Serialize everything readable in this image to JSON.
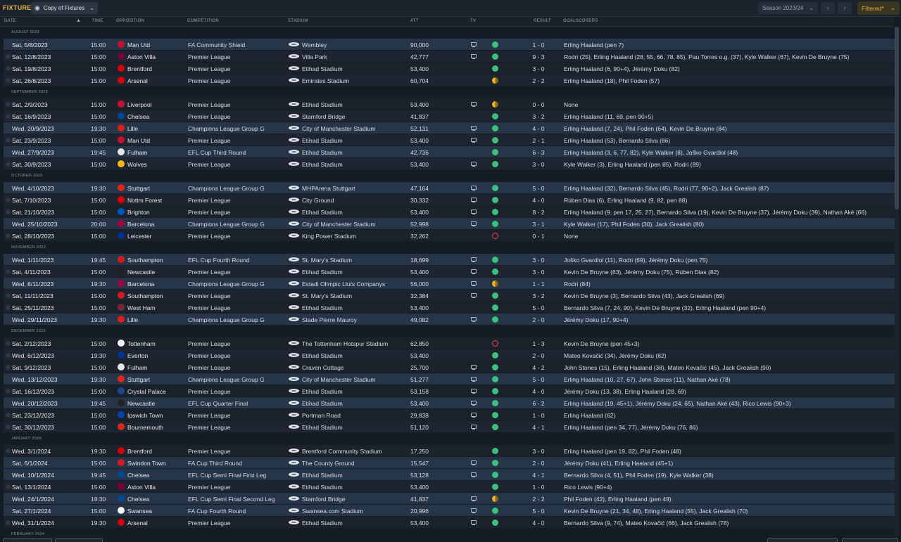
{
  "screen": {
    "title": "FIXTURES",
    "view_label": "Copy of Fixtures",
    "season_label": "Season 2023/24",
    "filter_label": "Filtered*"
  },
  "columns": {
    "date": "DATE",
    "time": "TIME",
    "opposition": "OPPOSITION",
    "competition": "COMPETITION",
    "stadium": "STADIUM",
    "att": "ATT",
    "tv": "TV",
    "result": "RESULT",
    "goalscorers": "GOALSCORERS"
  },
  "colors": {
    "win": "#3cc07f",
    "draw": "#f0b429",
    "loss": "#e04848",
    "accent": "#e3b341"
  },
  "months": [
    {
      "label": "AUGUST 2023",
      "fixtures": [
        {
          "date": "Sat, 5/8/2023",
          "time": "15:00",
          "opp": "Man Utd",
          "badge": "#c8102e",
          "comp": "FA Community Shield",
          "stadium": "Wembley",
          "att": "90,000",
          "tv": true,
          "outcome": "W",
          "score": "1 - 0",
          "goals": "Erling Haaland (pen 7)",
          "hl": true
        },
        {
          "date": "Sat, 12/8/2023",
          "time": "15:00",
          "opp": "Aston Villa",
          "badge": "#7a003c",
          "comp": "Premier League",
          "stadium": "Villa Park",
          "att": "42,777",
          "tv": true,
          "outcome": "W",
          "score": "9 - 3",
          "goals": "Rodri (25), Erling Haaland (28, 55, 66, 78, 85), Pau Torres o.g. (37), Kyle Walker (67), Kevin De Bruyne (75)"
        },
        {
          "date": "Sat, 19/8/2023",
          "time": "15:00",
          "opp": "Brentford",
          "badge": "#d20000",
          "comp": "Premier League",
          "stadium": "Etihad Stadium",
          "att": "53,400",
          "tv": false,
          "outcome": "W",
          "score": "3 - 0",
          "goals": "Erling Haaland (6, 90+4), Jérémy Doku (82)"
        },
        {
          "date": "Sat, 26/8/2023",
          "time": "15:00",
          "opp": "Arsenal",
          "badge": "#db0007",
          "comp": "Premier League",
          "stadium": "Emirates Stadium",
          "att": "60,704",
          "tv": false,
          "outcome": "D",
          "score": "2 - 2",
          "goals": "Erling Haaland (18), Phil Foden (57)"
        }
      ]
    },
    {
      "label": "SEPTEMBER 2023",
      "fixtures": [
        {
          "date": "Sat, 2/9/2023",
          "time": "15:00",
          "opp": "Liverpool",
          "badge": "#c8102e",
          "comp": "Premier League",
          "stadium": "Etihad Stadium",
          "att": "53,400",
          "tv": true,
          "outcome": "D",
          "score": "0 - 0",
          "goals": "None"
        },
        {
          "date": "Sat, 16/9/2023",
          "time": "15:00",
          "opp": "Chelsea",
          "badge": "#034694",
          "comp": "Premier League",
          "stadium": "Stamford Bridge",
          "att": "41,837",
          "tv": false,
          "outcome": "W",
          "score": "3 - 2",
          "goals": "Erling Haaland (11, 69, pen 90+5)"
        },
        {
          "date": "Wed, 20/9/2023",
          "time": "19:30",
          "opp": "Lille",
          "badge": "#e01e13",
          "comp": "Champions League Group G",
          "stadium": "City of Manchester Stadium",
          "att": "52,131",
          "tv": true,
          "outcome": "W",
          "score": "4 - 0",
          "goals": "Erling Haaland (7, 24), Phil Foden (64), Kevin De Bruyne (84)",
          "hl": true
        },
        {
          "date": "Sat, 23/9/2023",
          "time": "15:00",
          "opp": "Man Utd",
          "badge": "#c8102e",
          "comp": "Premier League",
          "stadium": "Etihad Stadium",
          "att": "53,400",
          "tv": true,
          "outcome": "W",
          "score": "2 - 1",
          "goals": "Erling Haaland (53), Bernardo Silva (86)"
        },
        {
          "date": "Wed, 27/9/2023",
          "time": "19:45",
          "opp": "Fulham",
          "badge": "#e6e6e6",
          "comp": "EFL Cup Third Round",
          "stadium": "Etihad Stadium",
          "att": "42,736",
          "tv": false,
          "outcome": "W",
          "score": "6 - 3",
          "goals": "Erling Haaland (3, 6, 77, 82), Kyle Walker (8), Joško Gvardiol (48)",
          "hl": true
        },
        {
          "date": "Sat, 30/9/2023",
          "time": "15:00",
          "opp": "Wolves",
          "badge": "#fdb913",
          "comp": "Premier League",
          "stadium": "Etihad Stadium",
          "att": "53,400",
          "tv": true,
          "outcome": "W",
          "score": "3 - 0",
          "goals": "Kyle Walker (3), Erling Haaland (pen 85), Rodri (89)"
        }
      ]
    },
    {
      "label": "OCTOBER 2023",
      "fixtures": [
        {
          "date": "Wed, 4/10/2023",
          "time": "19:30",
          "opp": "Stuttgart",
          "badge": "#e32219",
          "comp": "Champions League Group G",
          "stadium": "MHPArena Stuttgart",
          "att": "47,164",
          "tv": true,
          "outcome": "W",
          "score": "5 - 0",
          "goals": "Erling Haaland (32), Bernardo Silva (45), Rodri (77, 90+2), Jack Grealish (87)",
          "hl": true
        },
        {
          "date": "Sat, 7/10/2023",
          "time": "15:00",
          "opp": "Nottm Forest",
          "badge": "#dd0000",
          "comp": "Premier League",
          "stadium": "City Ground",
          "att": "30,332",
          "tv": true,
          "outcome": "W",
          "score": "4 - 0",
          "goals": "Rúben Dias (6), Erling Haaland (9, 82, pen 88)"
        },
        {
          "date": "Sat, 21/10/2023",
          "time": "15:00",
          "opp": "Brighton",
          "badge": "#0057b8",
          "comp": "Premier League",
          "stadium": "Etihad Stadium",
          "att": "53,400",
          "tv": true,
          "outcome": "W",
          "score": "8 - 2",
          "goals": "Erling Haaland (9, pen 17, 25, 27), Bernardo Silva (19), Kevin De Bruyne (37), Jérémy Doku (39), Nathan Aké (66)"
        },
        {
          "date": "Wed, 25/10/2023",
          "time": "20:00",
          "opp": "Barcelona",
          "badge": "#a50044",
          "comp": "Champions League Group G",
          "stadium": "City of Manchester Stadium",
          "att": "52,998",
          "tv": true,
          "outcome": "W",
          "score": "3 - 1",
          "goals": "Kyle Walker (17), Phil Foden (30), Jack Grealish (80)",
          "hl": true
        },
        {
          "date": "Sat, 28/10/2023",
          "time": "15:00",
          "opp": "Leicester",
          "badge": "#003090",
          "comp": "Premier League",
          "stadium": "King Power Stadium",
          "att": "32,262",
          "tv": false,
          "outcome": "L",
          "score": "0 - 1",
          "goals": "None"
        }
      ]
    },
    {
      "label": "NOVEMBER 2023",
      "fixtures": [
        {
          "date": "Wed, 1/11/2023",
          "time": "19:45",
          "opp": "Southampton",
          "badge": "#d71920",
          "comp": "EFL Cup Fourth Round",
          "stadium": "St. Mary's Stadium",
          "att": "18,699",
          "tv": true,
          "outcome": "W",
          "score": "3 - 0",
          "goals": "Joško Gvardiol (11), Rodri (69), Jérémy Doku (pen 75)",
          "hl": true
        },
        {
          "date": "Sat, 4/11/2023",
          "time": "15:00",
          "opp": "Newcastle",
          "badge": "#241f20",
          "comp": "Premier League",
          "stadium": "Etihad Stadium",
          "att": "53,400",
          "tv": true,
          "outcome": "W",
          "score": "3 - 0",
          "goals": "Kevin De Bruyne (63), Jérémy Doku (75), Rúben Dias (82)"
        },
        {
          "date": "Wed, 8/11/2023",
          "time": "19:30",
          "opp": "Barcelona",
          "badge": "#a50044",
          "comp": "Champions League Group G",
          "stadium": "Estadi Olímpic Lluís Companys",
          "att": "56,000",
          "tv": true,
          "outcome": "D",
          "score": "1 - 1",
          "goals": "Rodri (84)",
          "hl": true
        },
        {
          "date": "Sat, 11/11/2023",
          "time": "15:00",
          "opp": "Southampton",
          "badge": "#d71920",
          "comp": "Premier League",
          "stadium": "St. Mary's Stadium",
          "att": "32,384",
          "tv": true,
          "outcome": "W",
          "score": "3 - 2",
          "goals": "Kevin De Bruyne (3), Bernardo Silva (43), Jack Grealish (69)"
        },
        {
          "date": "Sat, 25/11/2023",
          "time": "15:00",
          "opp": "West Ham",
          "badge": "#7a263a",
          "comp": "Premier League",
          "stadium": "Etihad Stadium",
          "att": "53,400",
          "tv": false,
          "outcome": "W",
          "score": "5 - 0",
          "goals": "Bernardo Silva (7, 24, 90), Kevin De Bruyne (32), Erling Haaland (pen 90+4)"
        },
        {
          "date": "Wed, 29/11/2023",
          "time": "19:30",
          "opp": "Lille",
          "badge": "#e01e13",
          "comp": "Champions League Group G",
          "stadium": "Stade Pierre Mauroy",
          "att": "49,082",
          "tv": true,
          "outcome": "W",
          "score": "2 - 0",
          "goals": "Jérémy Doku (17, 90+4)",
          "hl": true
        }
      ]
    },
    {
      "label": "DECEMBER 2023",
      "fixtures": [
        {
          "date": "Sat, 2/12/2023",
          "time": "15:00",
          "opp": "Tottenham",
          "badge": "#f2f2f2",
          "comp": "Premier League",
          "stadium": "The Tottenham Hotspur Stadium",
          "att": "62,850",
          "tv": false,
          "outcome": "L",
          "score": "1 - 3",
          "goals": "Kevin De Bruyne (pen 45+3)"
        },
        {
          "date": "Wed, 6/12/2023",
          "time": "19:30",
          "opp": "Everton",
          "badge": "#003399",
          "comp": "Premier League",
          "stadium": "Etihad Stadium",
          "att": "53,400",
          "tv": false,
          "outcome": "W",
          "score": "2 - 0",
          "goals": "Mateo Kovačić (34), Jérémy Doku (82)"
        },
        {
          "date": "Sat, 9/12/2023",
          "time": "15:00",
          "opp": "Fulham",
          "badge": "#e6e6e6",
          "comp": "Premier League",
          "stadium": "Craven Cottage",
          "att": "25,700",
          "tv": true,
          "outcome": "W",
          "score": "4 - 2",
          "goals": "John Stones (15), Erling Haaland (38), Mateo Kovačić (45), Jack Grealish (90)"
        },
        {
          "date": "Wed, 13/12/2023",
          "time": "19:30",
          "opp": "Stuttgart",
          "badge": "#e32219",
          "comp": "Champions League Group G",
          "stadium": "City of Manchester Stadium",
          "att": "51,277",
          "tv": true,
          "outcome": "W",
          "score": "5 - 0",
          "goals": "Erling Haaland (10, 27, 67), John Stones (11), Nathan Aké (78)",
          "hl": true
        },
        {
          "date": "Sat, 16/12/2023",
          "time": "15:00",
          "opp": "Crystal Palace",
          "badge": "#1b458f",
          "comp": "Premier League",
          "stadium": "Etihad Stadium",
          "att": "53,158",
          "tv": true,
          "outcome": "W",
          "score": "4 - 0",
          "goals": "Jérémy Doku (13, 38), Erling Haaland (28, 69)"
        },
        {
          "date": "Wed, 20/12/2023",
          "time": "19:45",
          "opp": "Newcastle",
          "badge": "#241f20",
          "comp": "EFL Cup Quarter Final",
          "stadium": "Etihad Stadium",
          "att": "53,400",
          "tv": true,
          "outcome": "W",
          "score": "6 - 2",
          "goals": "Erling Haaland (19, 45+1), Jérémy Doku (24, 65), Nathan Aké (43), Rico Lewis (90+3)",
          "hl": true
        },
        {
          "date": "Sat, 23/12/2023",
          "time": "15:00",
          "opp": "Ipswich Town",
          "badge": "#0044aa",
          "comp": "Premier League",
          "stadium": "Portman Road",
          "att": "29,838",
          "tv": true,
          "outcome": "W",
          "score": "1 - 0",
          "goals": "Erling Haaland (62)"
        },
        {
          "date": "Sat, 30/12/2023",
          "time": "15:00",
          "opp": "Bournemouth",
          "badge": "#da291c",
          "comp": "Premier League",
          "stadium": "Etihad Stadium",
          "att": "51,120",
          "tv": true,
          "outcome": "W",
          "score": "4 - 1",
          "goals": "Erling Haaland (pen 34, 77), Jérémy Doku (76, 86)"
        }
      ]
    },
    {
      "label": "JANUARY 2024",
      "fixtures": [
        {
          "date": "Wed, 3/1/2024",
          "time": "19:30",
          "opp": "Brentford",
          "badge": "#d20000",
          "comp": "Premier League",
          "stadium": "Brentford Community Stadium",
          "att": "17,250",
          "tv": false,
          "outcome": "W",
          "score": "3 - 0",
          "goals": "Erling Haaland (pen 19, 82), Phil Foden (48)"
        },
        {
          "date": "Sat, 6/1/2024",
          "time": "15:00",
          "opp": "Swindon Town",
          "badge": "#d71920",
          "comp": "FA Cup Third Round",
          "stadium": "The County Ground",
          "att": "15,547",
          "tv": true,
          "outcome": "W",
          "score": "2 - 0",
          "goals": "Jérémy Doku (41), Erling Haaland (45+1)",
          "hl": true
        },
        {
          "date": "Wed, 10/1/2024",
          "time": "19:45",
          "opp": "Chelsea",
          "badge": "#034694",
          "comp": "EFL Cup Semi Final First Leg",
          "stadium": "Etihad Stadium",
          "att": "53,128",
          "tv": true,
          "outcome": "W",
          "score": "4 - 1",
          "goals": "Bernardo Silva (4, 51), Phil Foden (19), Kyle Walker (38)",
          "hl": true
        },
        {
          "date": "Sat, 13/1/2024",
          "time": "15:00",
          "opp": "Aston Villa",
          "badge": "#7a003c",
          "comp": "Premier League",
          "stadium": "Etihad Stadium",
          "att": "53,400",
          "tv": false,
          "outcome": "W",
          "score": "1 - 0",
          "goals": "Rico Lewis (90+4)"
        },
        {
          "date": "Wed, 24/1/2024",
          "time": "19:30",
          "opp": "Chelsea",
          "badge": "#034694",
          "comp": "EFL Cup Semi Final Second Leg",
          "stadium": "Stamford Bridge",
          "att": "41,837",
          "tv": true,
          "outcome": "D",
          "score": "2 - 2",
          "goals": "Phil Foden (42), Erling Haaland (pen 49)",
          "hl": true
        },
        {
          "date": "Sat, 27/1/2024",
          "time": "15:00",
          "opp": "Swansea",
          "badge": "#f2f2f2",
          "comp": "FA Cup Fourth Round",
          "stadium": "Swansea.com Stadium",
          "att": "20,996",
          "tv": true,
          "outcome": "W",
          "score": "5 - 0",
          "goals": "Kevin De Bruyne (21, 34, 48), Erling Haaland (55), Jack Grealish (70)",
          "hl": true
        },
        {
          "date": "Wed, 31/1/2024",
          "time": "19:30",
          "opp": "Arsenal",
          "badge": "#db0007",
          "comp": "Premier League",
          "stadium": "Etihad Stadium",
          "att": "53,400",
          "tv": true,
          "outcome": "W",
          "score": "4 - 0",
          "goals": "Bernardo Silva (9, 74), Mateo Kovačić (66), Jack Grealish (78)"
        }
      ]
    },
    {
      "label": "FEBRUARY 2024",
      "fixtures": []
    }
  ]
}
